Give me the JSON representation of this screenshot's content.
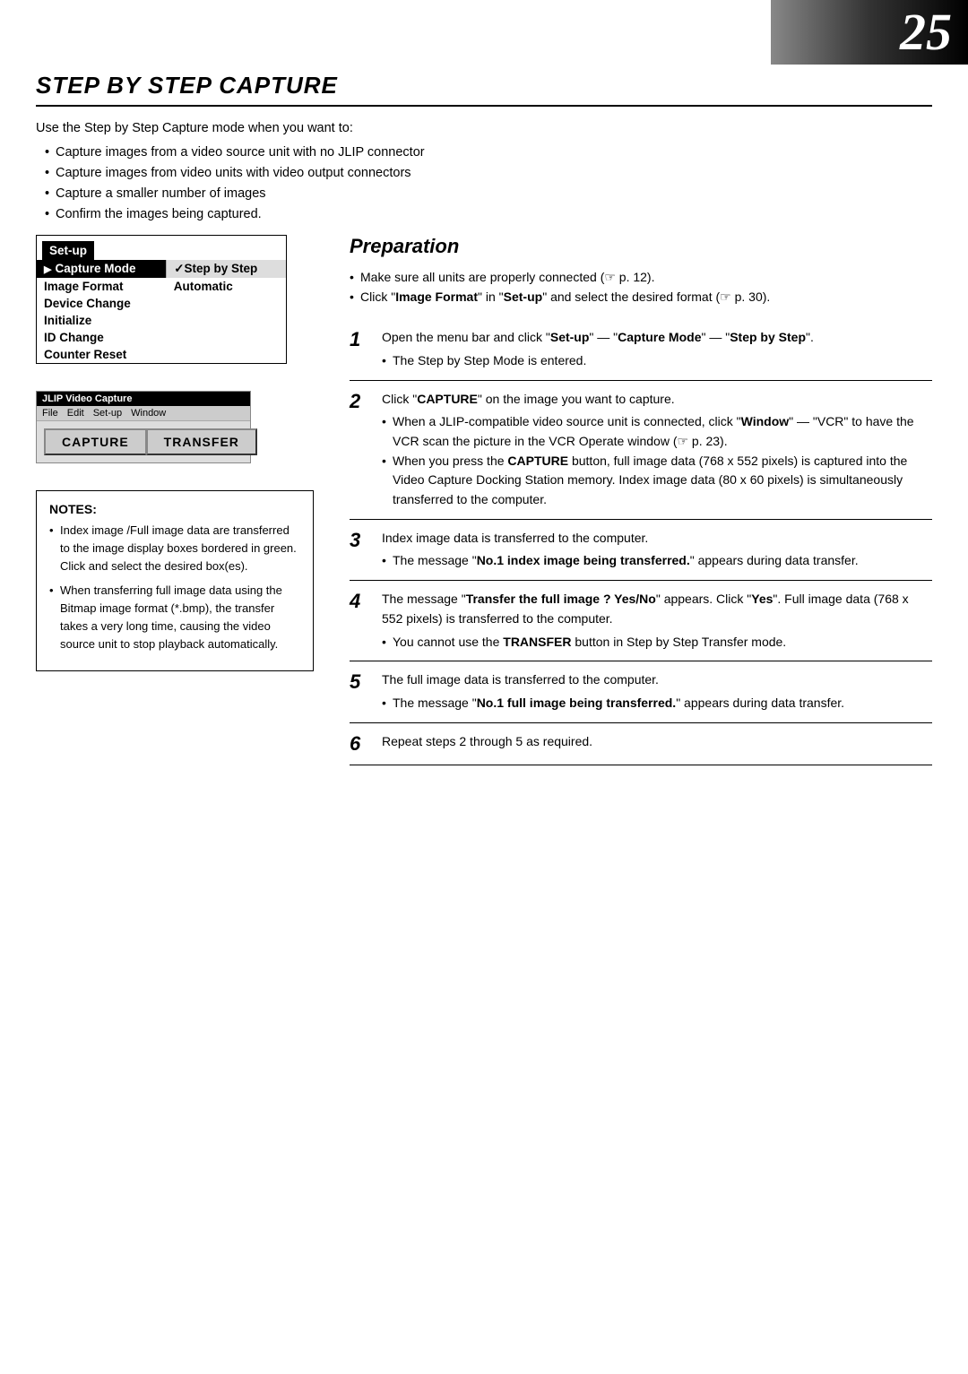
{
  "page": {
    "number": "25",
    "title": "STEP BY STEP CAPTURE"
  },
  "intro": {
    "lead": "Use the Step by Step Capture mode when you want to:",
    "bullets": [
      "Capture images from a video source unit with no JLIP connector",
      "Capture images from video units with video output connectors",
      "Capture a smaller number of images",
      "Confirm the images being captured."
    ]
  },
  "setup_menu": {
    "title": "Set-up",
    "rows": [
      {
        "label": "Capture Mode",
        "value": "✓Step by Step",
        "highlighted": true
      },
      {
        "label": "Image Format",
        "value": "Automatic",
        "highlighted": false
      },
      {
        "label": "Device Change",
        "value": "",
        "highlighted": false
      },
      {
        "label": "Initialize",
        "value": "",
        "highlighted": false
      },
      {
        "label": "ID Change",
        "value": "",
        "highlighted": false
      },
      {
        "label": "Counter Reset",
        "value": "",
        "highlighted": false
      }
    ]
  },
  "jlip_window": {
    "title": "JLIP Video Capture",
    "menu_items": [
      "File",
      "Edit",
      "Set-up",
      "Window"
    ],
    "capture_btn": "CAPTURE",
    "transfer_btn": "TRANSFER"
  },
  "preparation": {
    "heading": "Preparation",
    "bullets": [
      "Make sure all units are properly connected (☞ p. 12).",
      "Click \"Image Format\" in \"Set-up\" and select the desired format (☞ p. 30)."
    ]
  },
  "steps": [
    {
      "number": "1",
      "main": "Open the menu bar and click \"Set-up\" — \"Capture Mode\" — \"Step by Step\".",
      "sub_bullets": [
        "The Step by Step Mode is entered."
      ]
    },
    {
      "number": "2",
      "main": "Click \"CAPTURE\" on the image you want to capture.",
      "sub_bullets": [
        "When a JLIP-compatible video source unit is connected, click \"Window\" — \"VCR\" to have the VCR scan the picture in the VCR Operate window (☞ p. 23).",
        "When you press the CAPTURE button, full image data (768 x 552 pixels) is captured into the Video Capture Docking Station memory. Index image data (80 x 60 pixels) is simultaneously transferred to the computer."
      ]
    },
    {
      "number": "3",
      "main": "Index image data is transferred to the computer.",
      "sub_bullets": [
        "The message \"No.1 index image being transferred.\" appears during data transfer."
      ]
    },
    {
      "number": "4",
      "main": "The message \"Transfer the full image ? Yes/No\" appears.  Click \"Yes\". Full image data (768 x 552 pixels) is transferred to the computer.",
      "sub_bullets": [
        "You cannot use the TRANSFER button in  Step by Step Transfer mode."
      ]
    },
    {
      "number": "5",
      "main": "The full image data is transferred to the computer.",
      "sub_bullets": [
        "The message \"No.1 full image being transferred.\" appears during data transfer."
      ]
    },
    {
      "number": "6",
      "main": "Repeat steps 2 through 5 as required.",
      "sub_bullets": []
    }
  ],
  "notes": {
    "title": "NOTES:",
    "bullets": [
      "Index image /Full image data are transferred to the image display boxes bordered in green. Click and select the desired box(es).",
      "When transferring full image data using the Bitmap image format (*.bmp), the transfer takes a very long time, causing the video source unit to stop  playback automatically."
    ]
  }
}
